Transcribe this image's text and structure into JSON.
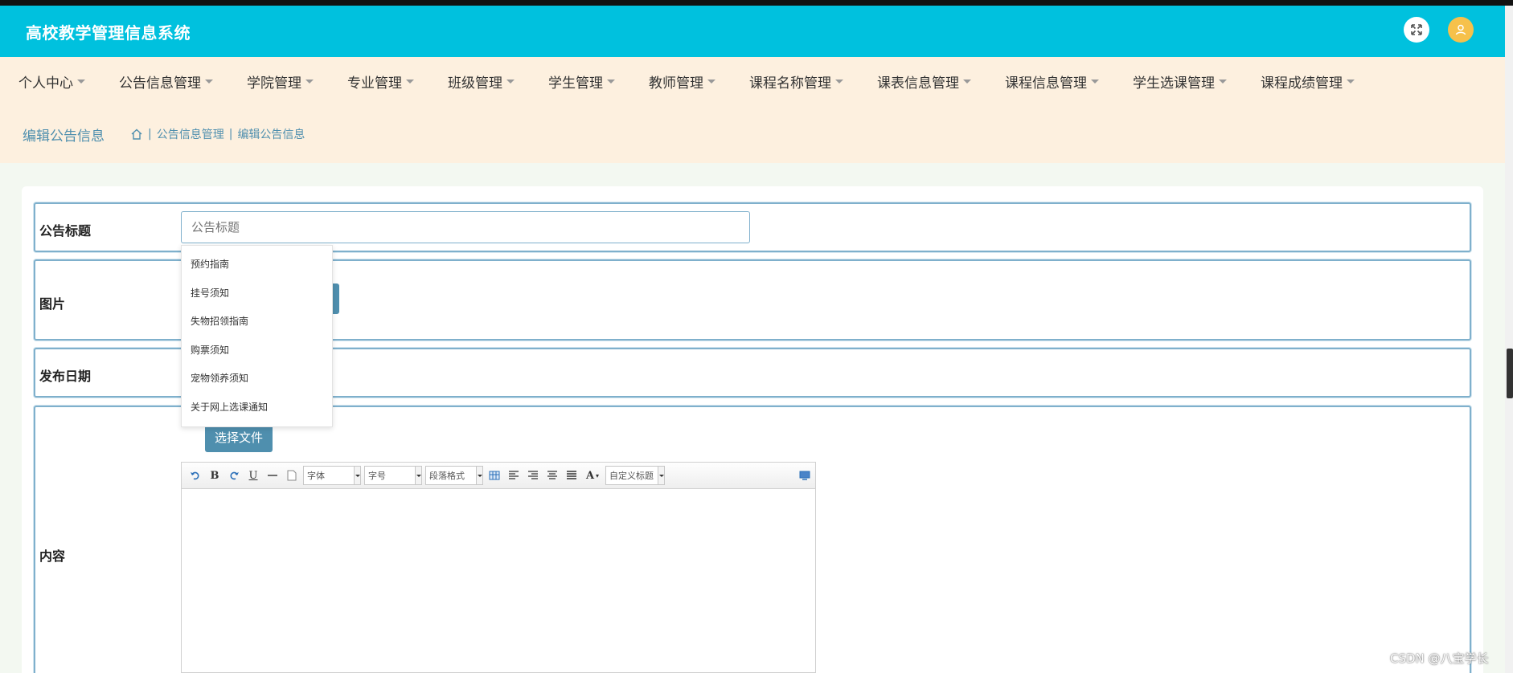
{
  "app": {
    "title": "高校教学管理信息系统"
  },
  "nav": {
    "items": [
      {
        "label": "个人中心"
      },
      {
        "label": "公告信息管理"
      },
      {
        "label": "学院管理"
      },
      {
        "label": "专业管理"
      },
      {
        "label": "班级管理"
      },
      {
        "label": "学生管理"
      },
      {
        "label": "教师管理"
      },
      {
        "label": "课程名称管理"
      },
      {
        "label": "课表信息管理"
      },
      {
        "label": "课程信息管理"
      },
      {
        "label": "学生选课管理"
      },
      {
        "label": "课程成绩管理"
      }
    ]
  },
  "breadcrumb": {
    "page_title": "编辑公告信息",
    "separator": "|",
    "items": [
      "公告信息管理",
      "编辑公告信息"
    ]
  },
  "form": {
    "title_label": "公告标题",
    "title_placeholder": "公告标题",
    "image_label": "图片",
    "date_label": "发布日期",
    "content_label": "内容",
    "file_button": "选择文件"
  },
  "autocomplete": {
    "options": [
      "预约指南",
      "挂号须知",
      "失物招领指南",
      "购票须知",
      "宠物领养须知",
      "关于网上选课通知"
    ]
  },
  "editor": {
    "font_family": "字体",
    "font_size": "字号",
    "paragraph": "段落格式",
    "custom_heading": "自定义标题"
  },
  "watermark": "CSDN @八宝学长",
  "colors": {
    "header_bg": "#00c1de",
    "nav_bg": "#fdf0df",
    "accent": "#4f8fae",
    "user_avatar": "#f6c14b"
  }
}
